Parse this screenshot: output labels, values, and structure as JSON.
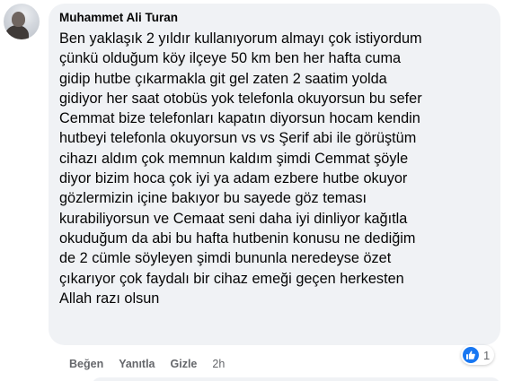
{
  "comment": {
    "author": "Muhammet Ali Turan",
    "text_lines": [
      "Ben yaklaşık 2 yıldır kullanıyorum almayı çok istiyordum",
      "çünkü olduğum köy ilçeye 50 km ben her hafta cuma",
      "gidip hutbe çıkarmakla git gel zaten 2 saatim yolda",
      "gidiyor her saat otobüs yok telefonla okuyorsun bu sefer",
      "Cemmat bize telefonları kapatın diyorsun hocam kendin",
      "hutbeyi telefonla okuyorsun vs vs Şerif abi ile görüştüm",
      "cihazı aldım çok memnun kaldım şimdi Cemmat şöyle",
      "diyor bizim hoca çok iyi ya adam ezbere hutbe okuyor",
      "gözlermizin içine bakıyor bu sayede göz teması",
      "kurabiliyorsun ve Cemaat seni daha iyi dinliyor kağıtla",
      "okuduğum da abi bu hafta hutbenin konusu ne dediğim",
      "de 2 cümle söyleyen şimdi bununla neredeyse özet",
      "çıkarıyor çok faydalı bir cihaz emeği geçen herkesten",
      "Allah razı olsun"
    ],
    "reaction": {
      "icon": "like-icon",
      "count": "1",
      "color": "#1877f2"
    },
    "actions": {
      "like": "Beğen",
      "reply": "Yanıtla",
      "hide": "Gizle",
      "time": "2h"
    }
  }
}
